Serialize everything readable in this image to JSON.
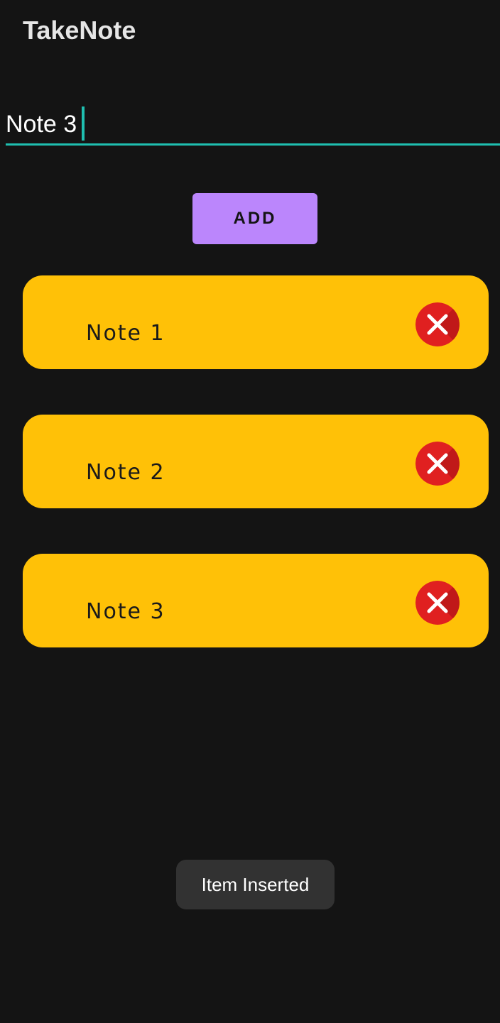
{
  "app": {
    "title": "TakeNote"
  },
  "input": {
    "value": "Note 3",
    "placeholder": ""
  },
  "add_button": {
    "label": "ADD"
  },
  "notes": [
    {
      "text": "Note 1"
    },
    {
      "text": "Note 2"
    },
    {
      "text": "Note 3"
    }
  ],
  "toast": {
    "message": "Item Inserted"
  },
  "colors": {
    "background": "#141414",
    "accent": "#1fbfb0",
    "button": "#bb86fc",
    "card": "#ffc107",
    "delete": "#e02020"
  },
  "icons": {
    "delete": "close-circle-icon"
  }
}
